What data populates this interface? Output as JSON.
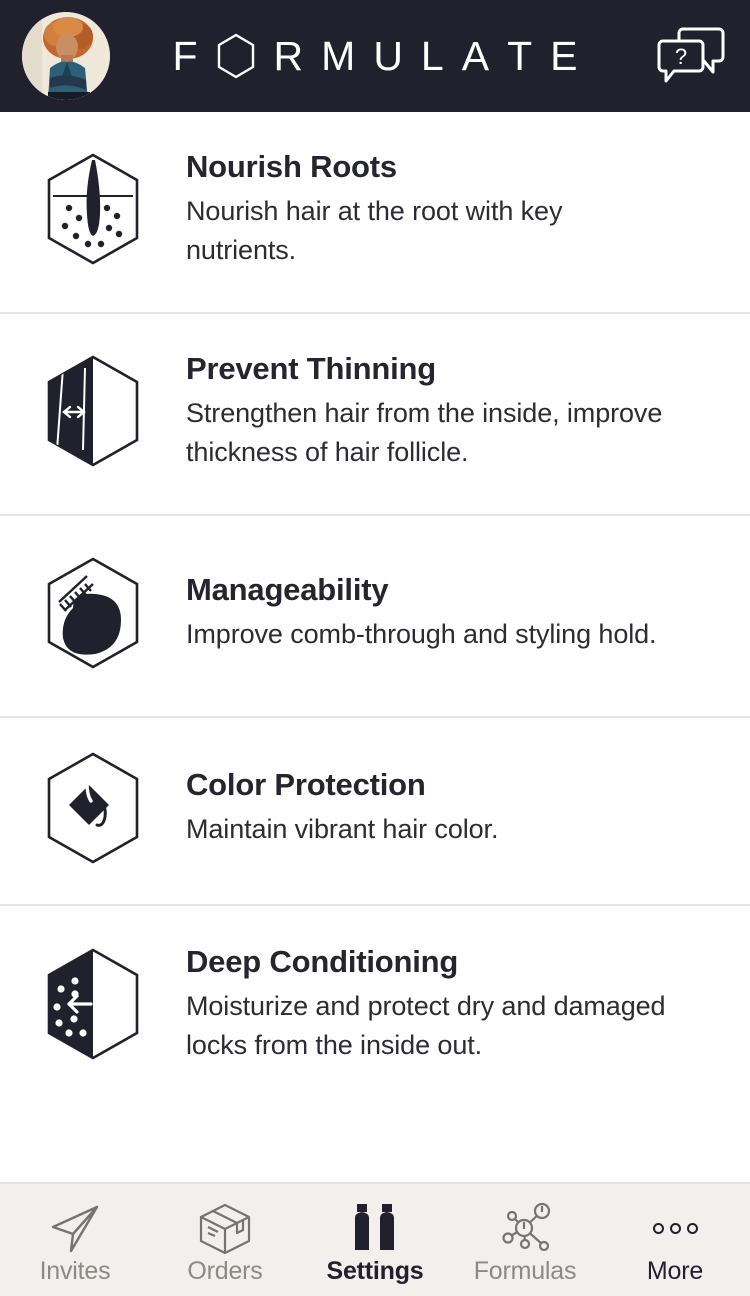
{
  "header": {
    "brand_name": "FORMULATE",
    "brand_letters": [
      "F",
      "HEX_O",
      "R",
      "M",
      "U",
      "L",
      "A",
      "T",
      "E"
    ],
    "avatar_name": "profile-avatar",
    "help_icon": "chat-question-icon",
    "background_color": "#21212e",
    "text_color": "#ffffff"
  },
  "benefits": [
    {
      "icon": "hair-follicle-root-hexagon-icon",
      "title": "Nourish Roots",
      "description": "Nourish hair at the root with key nutrients."
    },
    {
      "icon": "thickness-arrow-hexagon-icon",
      "title": "Prevent Thinning",
      "description": "Strengthen hair from the inside, improve thickness of hair follicle."
    },
    {
      "icon": "comb-hair-hexagon-icon",
      "title": "Manageability",
      "description": "Improve comb-through and styling hold."
    },
    {
      "icon": "color-dye-drop-hexagon-icon",
      "title": "Color Protection",
      "description": "Maintain vibrant hair color."
    },
    {
      "icon": "moisture-droplets-hexagon-icon",
      "title": "Deep Conditioning",
      "description": "Moisturize and protect dry and damaged locks from the inside out."
    }
  ],
  "tabbar": {
    "background_color": "#f2efec",
    "inactive_color": "#8d8984",
    "active_color": "#21212e",
    "items": [
      {
        "icon": "paper-plane-icon",
        "label": "Invites",
        "active": false
      },
      {
        "icon": "package-box-icon",
        "label": "Orders",
        "active": false
      },
      {
        "icon": "two-bottles-icon",
        "label": "Settings",
        "active": true
      },
      {
        "icon": "molecule-network-icon",
        "label": "Formulas",
        "active": false
      },
      {
        "icon": "three-dots-icon",
        "label": "More",
        "active": false
      }
    ]
  }
}
